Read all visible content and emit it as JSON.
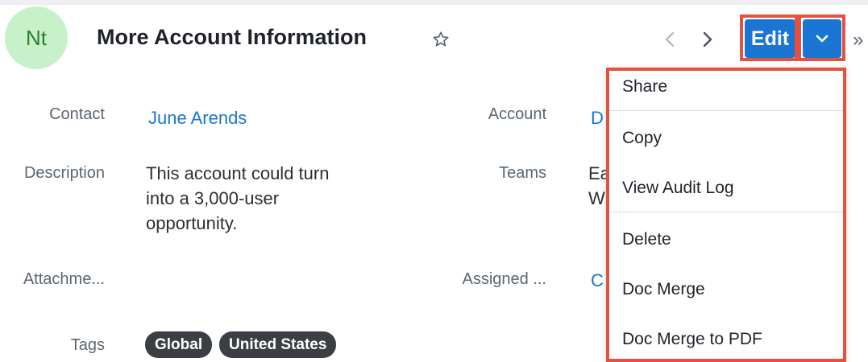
{
  "header": {
    "avatar_initials": "Nt",
    "title": "More Account Information",
    "edit_label": "Edit",
    "more_glyph": "»"
  },
  "fields": {
    "contact": {
      "label": "Contact",
      "value": "June Arends"
    },
    "account": {
      "label": "Account",
      "value": "D"
    },
    "description": {
      "label": "Description",
      "value_lines": [
        "This account could turn",
        "into a 3,000-user",
        "opportunity."
      ]
    },
    "teams": {
      "label": "Teams",
      "value_lines": [
        "Ea",
        "W"
      ]
    },
    "attachments": {
      "label": "Attachme..."
    },
    "assigned": {
      "label": "Assigned ...",
      "value": "C"
    },
    "tags": {
      "label": "Tags",
      "items": [
        "Global",
        "United States"
      ]
    }
  },
  "dropdown": {
    "items": [
      "Share",
      "Copy",
      "View Audit Log",
      "Delete",
      "Doc Merge",
      "Doc Merge to PDF"
    ]
  },
  "colors": {
    "accent": "#1a76d2",
    "highlight": "#e4513f",
    "avatar_bg": "#c7f2c9",
    "avatar_fg": "#2e7d32",
    "tag_bg": "#3b3f44"
  },
  "icons": [
    "star-icon",
    "chevron-left-icon",
    "chevron-right-icon",
    "chevron-down-icon",
    "double-chevron-right-icon"
  ]
}
